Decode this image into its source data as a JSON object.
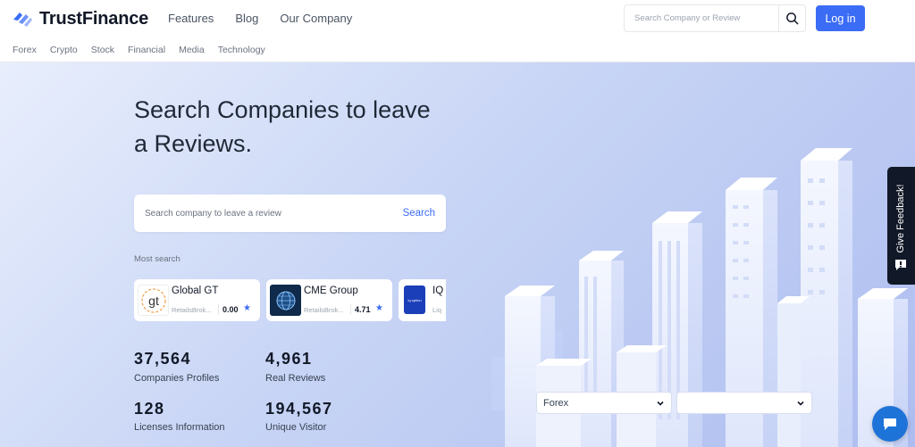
{
  "brand": {
    "name": "TrustFinance",
    "color": "#3b6cf6"
  },
  "nav": {
    "main": [
      "Features",
      "Blog",
      "Our Company"
    ],
    "categories": [
      "Forex",
      "Crypto",
      "Stock",
      "Financial",
      "Media",
      "Technology"
    ]
  },
  "header": {
    "search_placeholder": "Search Company or Review",
    "login_label": "Log in"
  },
  "hero": {
    "title": "Search Companies to leave a Reviews.",
    "search_placeholder": "Search company to leave a review",
    "search_button": "Search",
    "most_search_label": "Most search"
  },
  "companies": [
    {
      "name": "Global GT",
      "category": "RetailsBrok...",
      "rating": "0.00",
      "logo": "gt-logo"
    },
    {
      "name": "CME Group",
      "category": "RetailsBrok...",
      "rating": "4.71",
      "logo": "globe-logo"
    },
    {
      "name": "IQ",
      "category": "Liq",
      "rating": "",
      "logo": "iq-option-logo",
      "logo_text": "iq option"
    }
  ],
  "stats": [
    {
      "value": "37,564",
      "label": "Companies Profiles"
    },
    {
      "value": "4,961",
      "label": "Real Reviews"
    },
    {
      "value": "128",
      "label": "Licenses Information"
    },
    {
      "value": "194,567",
      "label": "Unique Visitor"
    }
  ],
  "filters": {
    "first": "Forex",
    "second": ""
  },
  "feedback": {
    "label": "Give Feedback!"
  },
  "icons": [
    "logo-icon",
    "search-icon",
    "star-icon",
    "chevron-down-icon",
    "chat-icon",
    "feedback-icon"
  ]
}
